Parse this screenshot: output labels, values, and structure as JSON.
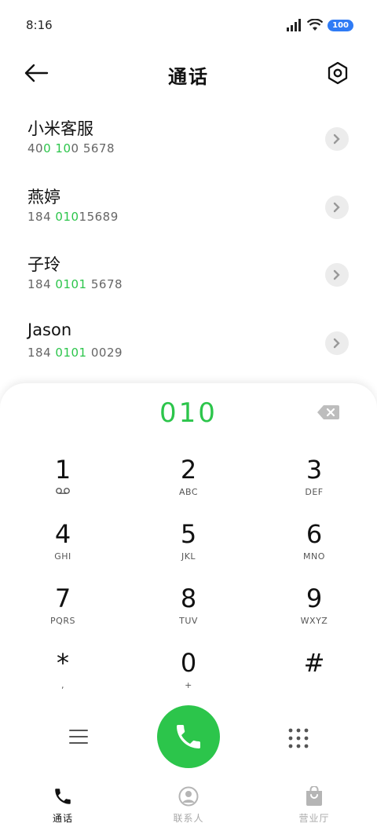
{
  "status": {
    "time": "8:16",
    "battery": "100"
  },
  "header": {
    "title": "通话"
  },
  "contacts": [
    {
      "name": "小米客服",
      "num_pre": "40",
      "num_hl1": "0",
      "num_mid": " ",
      "num_hl2": "10",
      "num_post": "0 5678"
    },
    {
      "name": "燕婷",
      "num_pre": "184 ",
      "num_hl1": "010",
      "num_mid": "",
      "num_hl2": "",
      "num_post": "15689"
    },
    {
      "name": "子玲",
      "num_pre": "184 ",
      "num_hl1": "0101",
      "num_mid": "",
      "num_hl2": "",
      "num_post": " 5678"
    },
    {
      "name": "Jason",
      "num_pre": "184 ",
      "num_hl1": "0101",
      "num_mid": "",
      "num_hl2": "",
      "num_post": " 0029"
    }
  ],
  "dialer": {
    "input": "010",
    "keys": [
      {
        "digit": "1",
        "letters": ""
      },
      {
        "digit": "2",
        "letters": "ABC"
      },
      {
        "digit": "3",
        "letters": "DEF"
      },
      {
        "digit": "4",
        "letters": "GHI"
      },
      {
        "digit": "5",
        "letters": "JKL"
      },
      {
        "digit": "6",
        "letters": "MNO"
      },
      {
        "digit": "7",
        "letters": "PQRS"
      },
      {
        "digit": "8",
        "letters": "TUV"
      },
      {
        "digit": "9",
        "letters": "WXYZ"
      },
      {
        "digit": "*",
        "letters": ","
      },
      {
        "digit": "0",
        "letters": "+"
      },
      {
        "digit": "#",
        "letters": ""
      }
    ]
  },
  "nav": {
    "calls": "通话",
    "contacts": "联系人",
    "hall": "营业厅"
  },
  "colors": {
    "accent": "#2cc54b",
    "battery": "#2f7bf5"
  }
}
